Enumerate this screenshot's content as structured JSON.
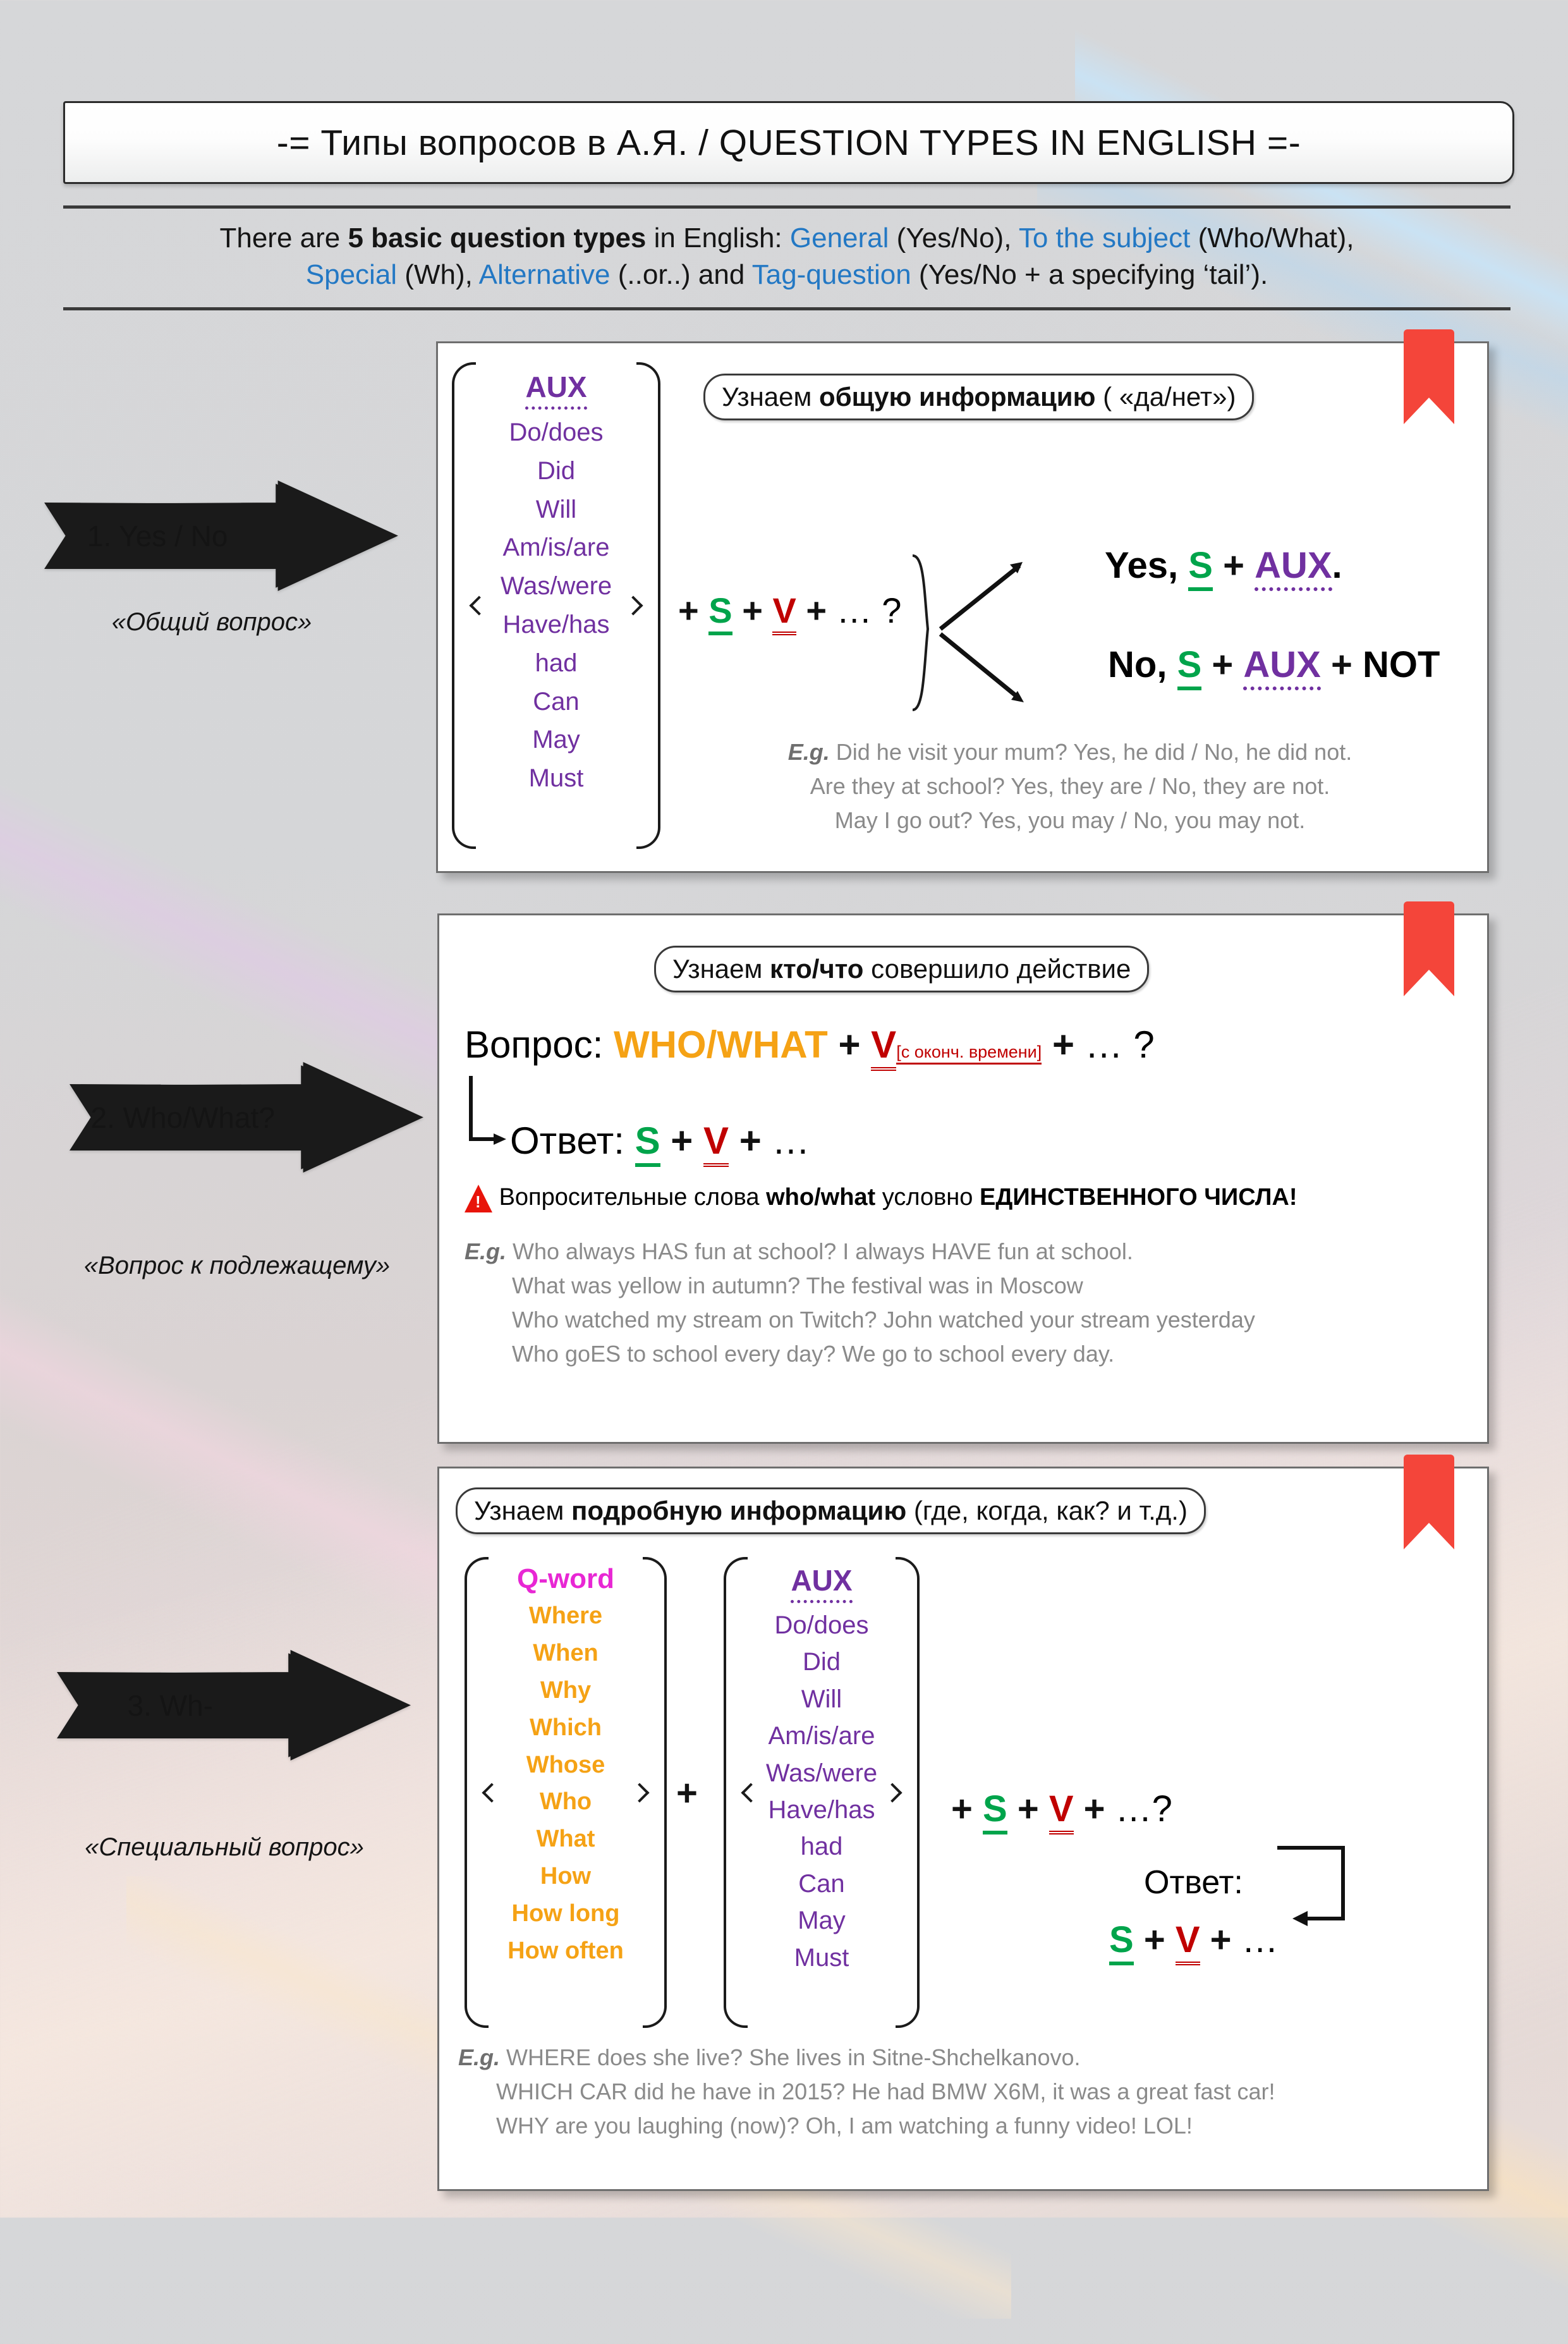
{
  "title": "-= Типы вопросов в А.Я. / QUESTION TYPES IN ENGLISH =-",
  "intro": {
    "line1_a": "There are ",
    "line1_b": "5 basic question types",
    "line1_c": " in English: ",
    "line1_d": "General",
    "line1_e": " (Yes/No), ",
    "line1_f": "To the subject",
    "line1_g": " (Who/What),",
    "line2_a": "Special",
    "line2_b": " (Wh), ",
    "line2_c": "Alternative",
    "line2_d": " (..or..) and ",
    "line2_e": "Tag-question",
    "line2_f": " (Yes/No + a specifying ‘tail’)."
  },
  "colors": {
    "accent_blue": "#2378C4",
    "aux_purple": "#7030A0",
    "subject_green": "#00A44B",
    "verb_red": "#C00000",
    "qword_orange": "#F5A215",
    "qword_magenta": "#E827D4",
    "bookmark_red": "#F4453A",
    "warning_red": "#E8140A"
  },
  "sections": [
    {
      "arrow_label": "1. Yes / No",
      "arrow_caption": "«Общий вопрос»",
      "banner_plain_a": "Узнаем ",
      "banner_bold": "общую информацию",
      "banner_plain_b": " ( «да/нет»)",
      "aux_heading": "AUX",
      "aux_items": [
        "Do/does",
        "Did",
        "Will",
        "Am/is/are",
        "Was/were",
        "Have/has",
        "had",
        "Can",
        "May",
        "Must"
      ],
      "formula": {
        "plus1": "+",
        "S": "S",
        "plus2": "+",
        "V": "V",
        "plus3": "+",
        "ellipsis": "… ?"
      },
      "answer_yes": {
        "word": "Yes,",
        "S": "S",
        "plus": "+",
        "AUX": "AUX",
        "dot": "."
      },
      "answer_no": {
        "word": "No,",
        "S": "S",
        "plus1": "+",
        "AUX": "AUX",
        "plus2": "+",
        "NOT": "NOT"
      },
      "examples_label": "E.g.",
      "examples": [
        "Did he visit your mum? Yes, he did / No, he did not.",
        "Are they at school? Yes, they are / No, they are not.",
        "May I go out? Yes, you may / No, you may not."
      ]
    },
    {
      "arrow_label": "2. Who/What?",
      "arrow_caption": "«Вопрос к подлежащему»",
      "banner_plain_a": "Узнаем ",
      "banner_bold": "кто/что",
      "banner_plain_b": " совершило действие",
      "question_label": "Вопрос:",
      "question_word": "WHO/WHAT",
      "question_plus1": "+",
      "question_V": "V",
      "question_V_note": "[с оконч. времени]",
      "question_plus2": "+",
      "question_tail": "… ?",
      "answer_label": "Ответ:",
      "answer_S": "S",
      "answer_plus1": "+",
      "answer_V": "V",
      "answer_plus2": "+",
      "answer_tail": "…",
      "warning": {
        "plain_a": "Вопросительные слова ",
        "bold_a": "who/what",
        "plain_b": " условно ",
        "bold_b": "ЕДИНСТВЕННОГО ЧИСЛА!"
      },
      "examples_label": "E.g.",
      "examples": [
        "Who always HAS fun at school? I always HAVE fun at school.",
        "What was yellow in autumn? The festival was in Moscow",
        "Who watched my stream on Twitch? John watched your stream yesterday",
        "Who goES to school every day? We go to school every day."
      ]
    },
    {
      "arrow_label": "3. Wh-",
      "arrow_caption": "«Специальный вопрос»",
      "banner_plain_a": "Узнаем ",
      "banner_bold": "подробную информацию",
      "banner_plain_b": " (где, когда, как? и т.д.)",
      "qword_heading": "Q-word",
      "qword_items": [
        "Where",
        "When",
        "Why",
        "Which",
        "Whose",
        "Who",
        "What",
        "How",
        "How long",
        "How often"
      ],
      "join_plus": "+",
      "aux_heading": "AUX",
      "aux_items": [
        "Do/does",
        "Did",
        "Will",
        "Am/is/are",
        "Was/were",
        "Have/has",
        "had",
        "Can",
        "May",
        "Must"
      ],
      "formula": {
        "plus1": "+",
        "S": "S",
        "plus2": "+",
        "V": "V",
        "plus3": "+",
        "ellipsis": "…?"
      },
      "answer_label": "Ответ:",
      "answer_S": "S",
      "answer_plus1": "+",
      "answer_V": "V",
      "answer_plus2": "+",
      "answer_tail": "…",
      "examples_label": "E.g.",
      "examples": [
        "WHERE does she live? She lives in Sitne-Shchelkanovo.",
        "WHICH CAR did he have in 2015? He had BMW X6M, it was a great fast car!",
        "WHY are you laughing (now)? Oh, I am watching a funny video! LOL!"
      ]
    }
  ]
}
